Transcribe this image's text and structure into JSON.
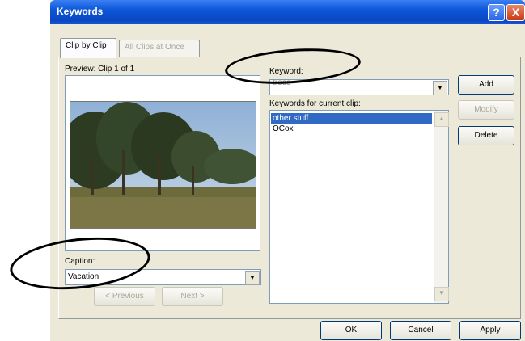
{
  "window": {
    "title": "Keywords",
    "help_glyph": "?",
    "close_glyph": "X"
  },
  "tabs": [
    {
      "label": "Clip by Clip"
    },
    {
      "label": "All Clips at Once"
    }
  ],
  "preview": {
    "label": "Preview:  Clip 1 of 1"
  },
  "caption": {
    "label": "Caption:",
    "value": "Vacation"
  },
  "keyword": {
    "label": "Keyword:",
    "value": "trees"
  },
  "keywords_list": {
    "label": "Keywords for current clip:",
    "items": [
      "other stuff",
      "OCox"
    ]
  },
  "buttons": {
    "add": "Add",
    "modify": "Modify",
    "delete": "Delete",
    "previous": "< Previous",
    "next": "Next >",
    "ok": "OK",
    "cancel": "Cancel",
    "apply": "Apply"
  },
  "annotations": {
    "color": "#000000"
  }
}
